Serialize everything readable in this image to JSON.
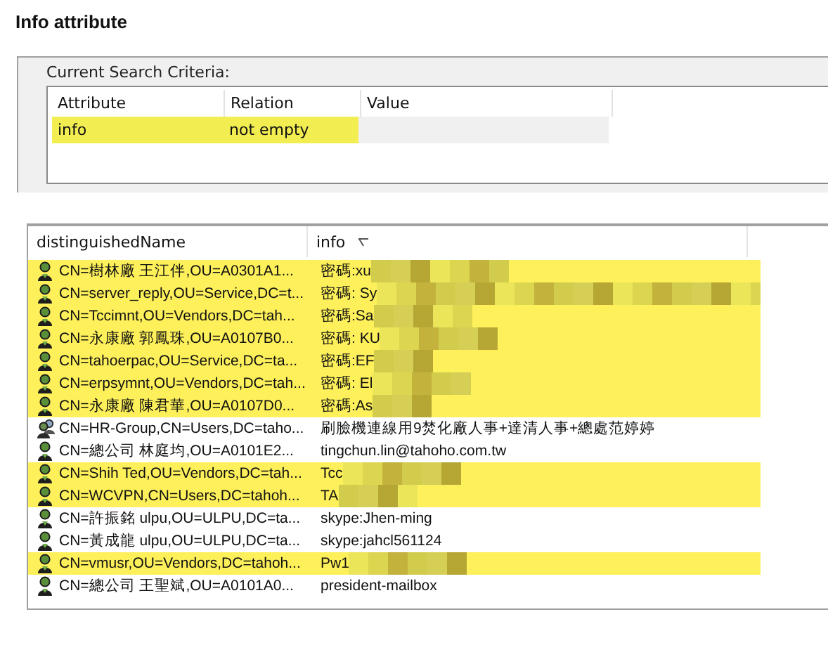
{
  "heading": "Info attribute",
  "criteria": {
    "label": "Current Search Criteria:",
    "columns": [
      "Attribute",
      "Relation",
      "Value"
    ],
    "rows": [
      {
        "cells": [
          "info",
          "not empty",
          ""
        ],
        "highlighted": true
      }
    ]
  },
  "results": {
    "columns": [
      {
        "label": "distinguishedName",
        "sorted": false
      },
      {
        "label": "info",
        "sorted": true
      }
    ],
    "rows": [
      {
        "kind": "user",
        "name": "CN=樹林廠 王江伴,OU=A0301A1...",
        "info": "密碼:xu",
        "highlighted": true,
        "redacted": true
      },
      {
        "kind": "user",
        "name": "CN=server_reply,OU=Service,DC=t...",
        "info": "密碼: Sy",
        "highlighted": true,
        "redacted": true
      },
      {
        "kind": "user",
        "name": "CN=Tccimnt,OU=Vendors,DC=tah...",
        "info": "密碼:Sa",
        "highlighted": true,
        "redacted": true
      },
      {
        "kind": "user",
        "name": "CN=永康廠 郭鳳珠,OU=A0107B0...",
        "info": "密碼: KU",
        "highlighted": true,
        "redacted": true
      },
      {
        "kind": "user",
        "name": "CN=tahoerpac,OU=Service,DC=ta...",
        "info": "密碼:EF",
        "highlighted": true,
        "redacted": true
      },
      {
        "kind": "user",
        "name": "CN=erpsymnt,OU=Vendors,DC=tah...",
        "info": "密碼: El",
        "highlighted": true,
        "redacted": true
      },
      {
        "kind": "user",
        "name": "CN=永康廠 陳君華,OU=A0107D0...",
        "info": "密碼:As",
        "highlighted": true,
        "redacted": true
      },
      {
        "kind": "group",
        "name": "CN=HR-Group,CN=Users,DC=taho...",
        "info": "刷臉機連線用9焚化廠人事+達清人事+總處范婷婷",
        "highlighted": false,
        "redacted": false
      },
      {
        "kind": "user",
        "name": "CN=總公司 林庭均,OU=A0101E2...",
        "info": "tingchun.lin@tahoho.com.tw",
        "highlighted": false,
        "redacted": false
      },
      {
        "kind": "user",
        "name": "CN=Shih Ted,OU=Vendors,DC=tah...",
        "info": "Tcc",
        "highlighted": true,
        "redacted": true
      },
      {
        "kind": "user",
        "name": "CN=WCVPN,CN=Users,DC=tahoh...",
        "info": "TA",
        "highlighted": true,
        "redacted": true
      },
      {
        "kind": "user",
        "name": "CN=許振銘 ulpu,OU=ULPU,DC=ta...",
        "info": "skype:Jhen-ming",
        "highlighted": false,
        "redacted": false
      },
      {
        "kind": "user",
        "name": "CN=黃成龍 ulpu,OU=ULPU,DC=ta...",
        "info": "skype:jahcl561124",
        "highlighted": false,
        "redacted": false
      },
      {
        "kind": "user",
        "name": "CN=vmusr,OU=Vendors,DC=tahoh...",
        "info": "Pw1",
        "highlighted": true,
        "redacted": true
      },
      {
        "kind": "user",
        "name": "CN=總公司 王聖斌,OU=A0101A0...",
        "info": "president-mailbox",
        "highlighted": false,
        "redacted": false
      }
    ]
  }
}
